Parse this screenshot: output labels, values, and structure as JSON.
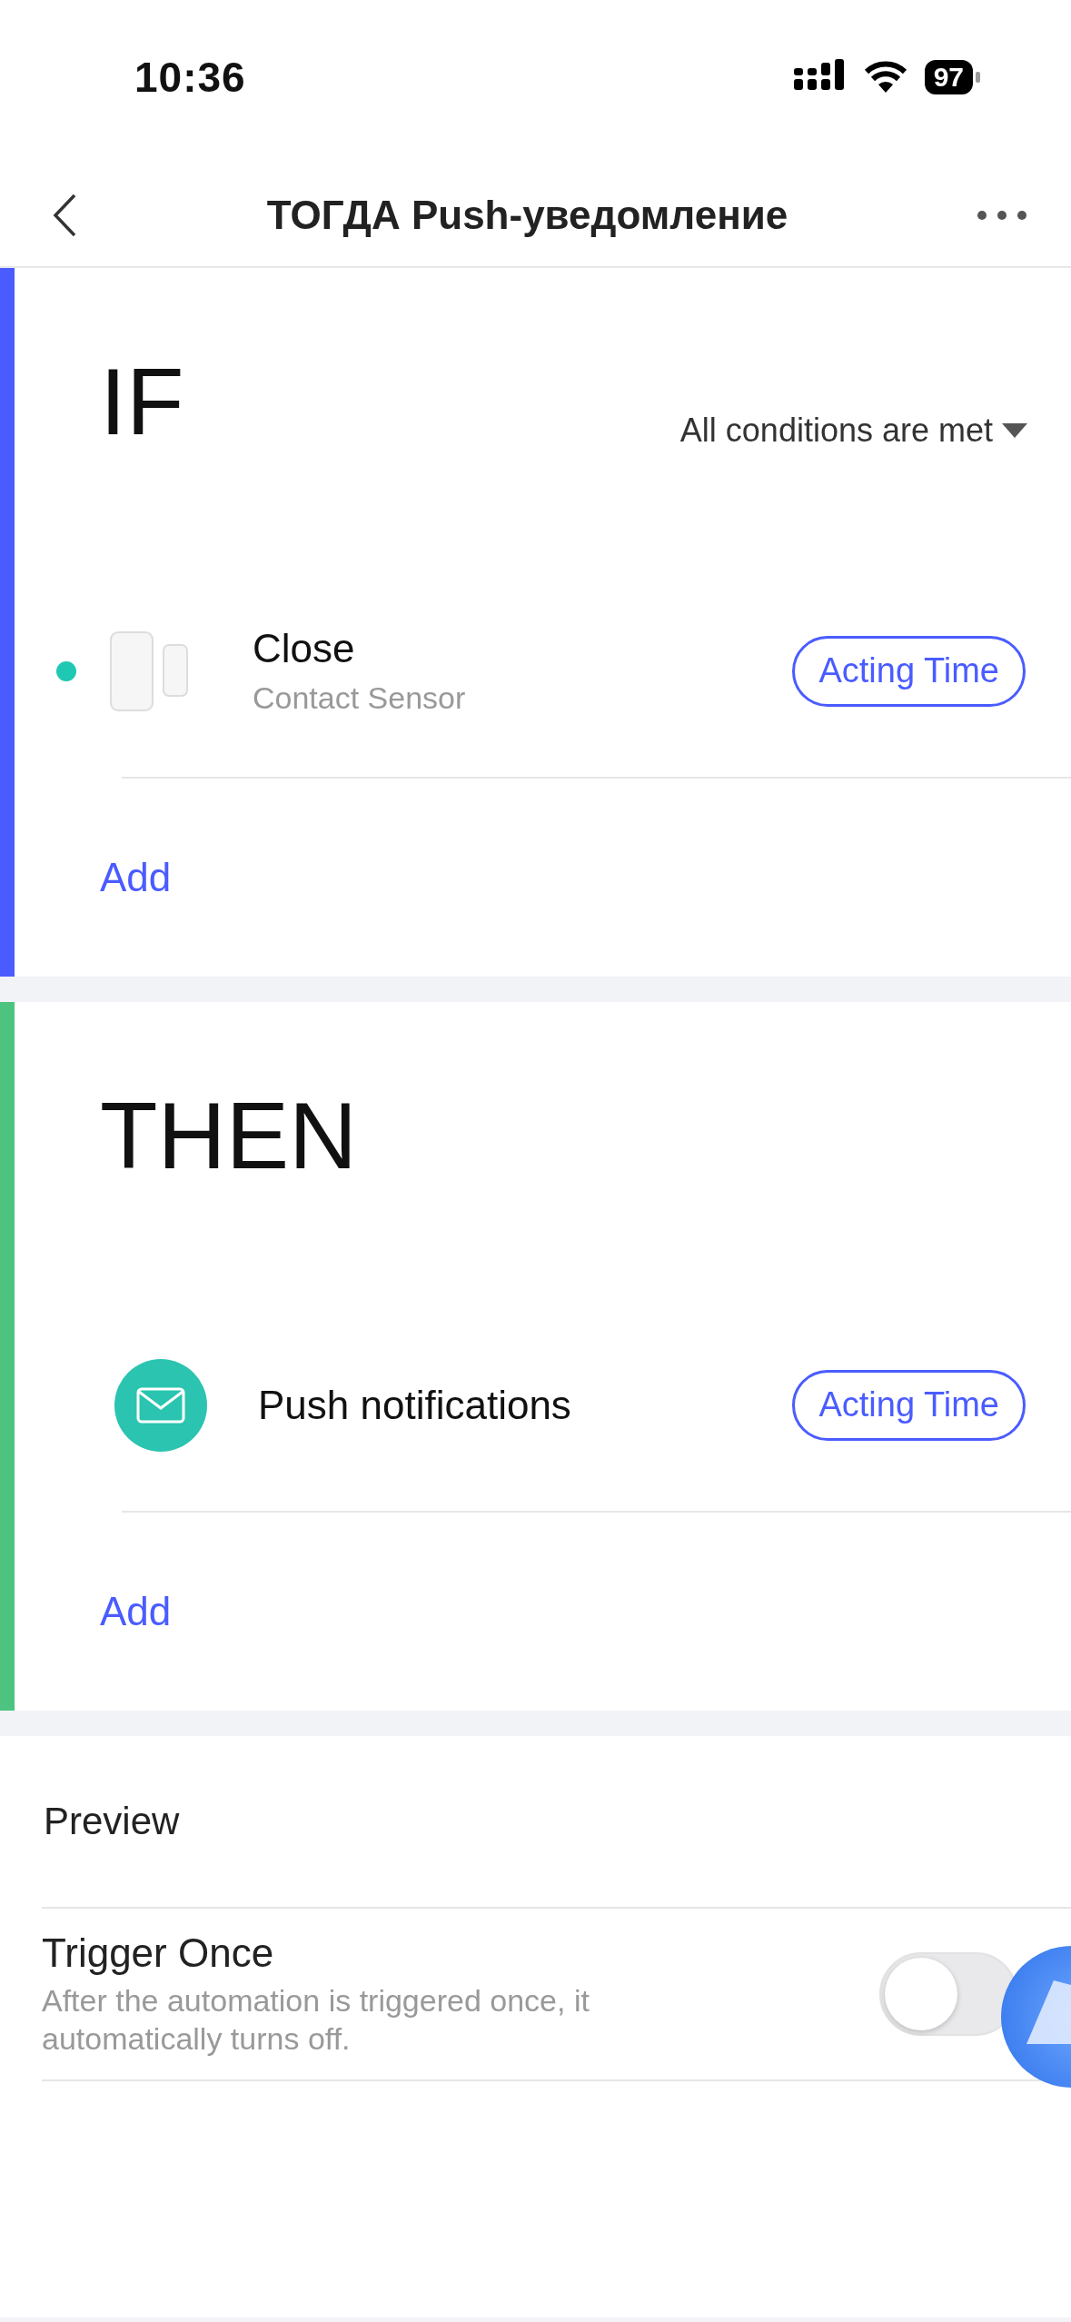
{
  "status_bar": {
    "time": "10:36",
    "battery": "97"
  },
  "header": {
    "title": "ТОГДА Push-уведомление"
  },
  "sections": [
    {
      "kind": "if",
      "heading": "IF",
      "color": "#4a5cff",
      "match_mode": "All conditions are met",
      "items": [
        {
          "kind": "sensor",
          "title": "Close",
          "subtitle": "Contact Sensor",
          "action": "Acting Time",
          "color": "#1fc8b2"
        }
      ],
      "add_label": "Add"
    },
    {
      "kind": "then",
      "heading": "THEN",
      "color": "#4cc47f",
      "items": [
        {
          "kind": "notification",
          "title": "Push notifications",
          "action": "Acting Time"
        }
      ],
      "add_label": "Add"
    }
  ],
  "preview": {
    "label": "Preview"
  },
  "trigger_once": {
    "title": "Trigger Once",
    "description": "After the automation is triggered once, it automatically turns off.",
    "on": false
  }
}
